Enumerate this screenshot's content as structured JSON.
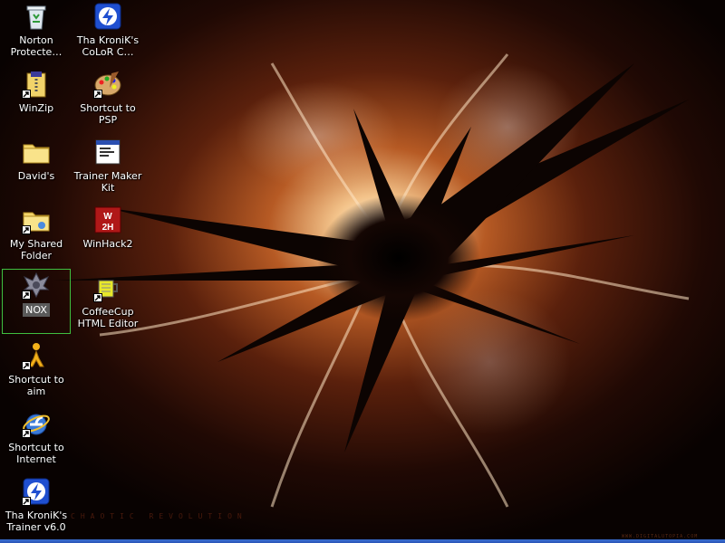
{
  "desktop": {
    "icons": [
      {
        "label": "Norton\nProtecte…",
        "icon": "recycle-bin-icon"
      },
      {
        "label": "Tha KroniK's\nCoLoR C…",
        "icon": "blue-disk-icon",
        "shortcut": false
      },
      {
        "label": "WinZip",
        "icon": "winzip-icon",
        "shortcut": true
      },
      {
        "label": "Shortcut to PSP",
        "icon": "palette-icon",
        "shortcut": true
      },
      {
        "label": "David's",
        "icon": "folder-icon"
      },
      {
        "label": "Trainer Maker\nKit",
        "icon": "window-icon"
      },
      {
        "label": "My Shared\nFolder",
        "icon": "shared-folder-icon",
        "shortcut": true
      },
      {
        "label": "WinHack2",
        "icon": "winhack-icon"
      },
      {
        "label": "NOX",
        "icon": "nox-icon",
        "shortcut": true,
        "selected": true
      },
      {
        "label": "CoffeeCup\nHTML Editor",
        "icon": "coffee-cup-icon",
        "shortcut": true
      },
      {
        "label": "Shortcut to aim",
        "icon": "aim-icon",
        "shortcut": true
      },
      {
        "label": "Shortcut to\nInternet",
        "icon": "ie-icon",
        "shortcut": true
      },
      {
        "label": "Tha KroniK's\nTrainer v6.0",
        "icon": "blue-disk-icon",
        "shortcut": true
      }
    ]
  },
  "wallpaper": {
    "caption": "CHAOTIC  REVOLUTION",
    "credit": "WWW.DIGITALUTOPIA.COM"
  },
  "colors": {
    "selection_outline": "#3fbf3f",
    "selection_label_bg": "#5a5a5a"
  }
}
